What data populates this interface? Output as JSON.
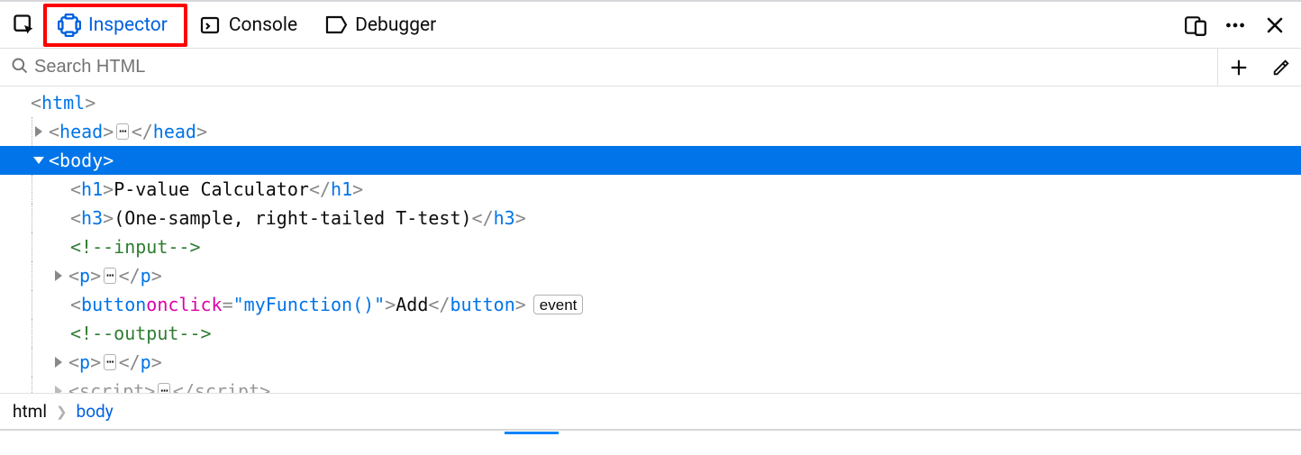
{
  "toolbar": {
    "tabs": {
      "inspector": "Inspector",
      "console": "Console",
      "debugger": "Debugger"
    }
  },
  "search": {
    "placeholder": "Search HTML"
  },
  "tree": {
    "html_tag": "html",
    "head_tag": "head",
    "body_tag": "body",
    "h1_tag": "h1",
    "h1_text": "P-value Calculator",
    "h3_tag": "h3",
    "h3_text": "(One-sample, right-tailed T-test)",
    "comment_input": "<!--input-->",
    "p_tag": "p",
    "button_tag": "button",
    "button_attr_name": "onclick",
    "button_attr_value": "\"myFunction()\"",
    "button_text": "Add",
    "event_badge": "event",
    "comment_output": "<!--output-->",
    "script_tag": "script",
    "ellipsis": "⋯"
  },
  "breadcrumbs": {
    "root": "html",
    "current": "body"
  }
}
